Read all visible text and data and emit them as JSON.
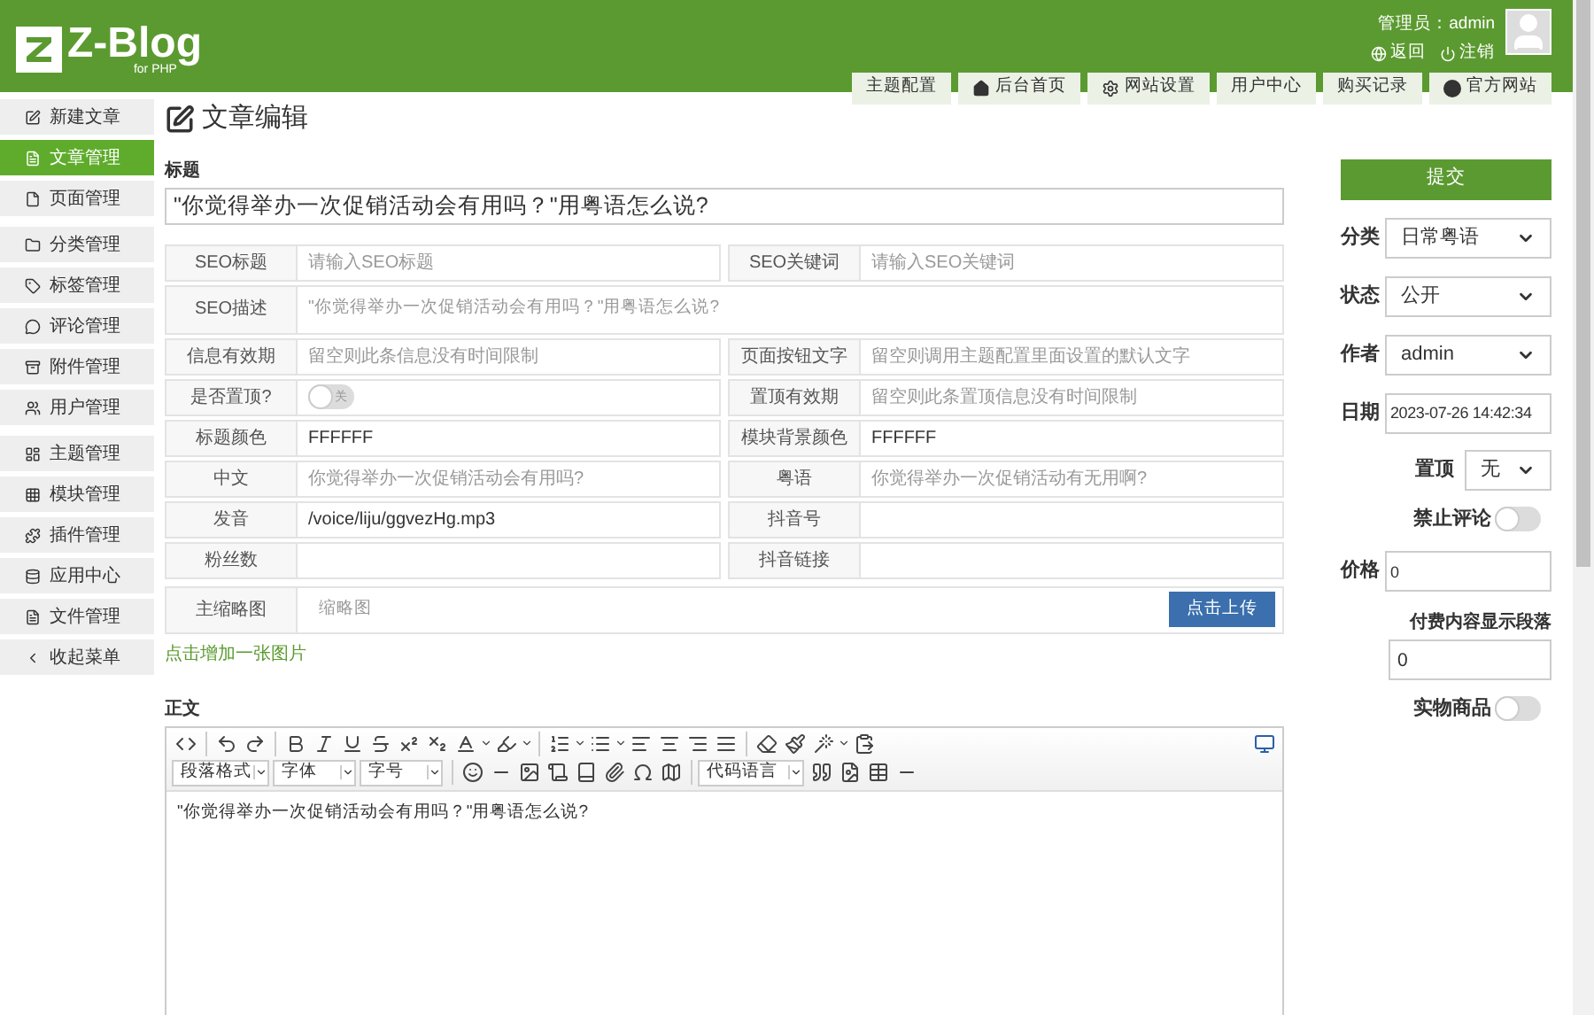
{
  "header": {
    "logo": "Z-Blog",
    "logo_sub": "for PHP",
    "user_label": "管理员：admin",
    "links": [
      "返回",
      "注销"
    ],
    "tabs": [
      {
        "label": "主题配置"
      },
      {
        "label": "后台首页"
      },
      {
        "label": "网站设置"
      },
      {
        "label": "用户中心"
      },
      {
        "label": "购买记录"
      },
      {
        "label": "官方网站"
      }
    ]
  },
  "sidebar": {
    "groups": [
      [
        {
          "label": "新建文章",
          "selected": false
        },
        {
          "label": "文章管理",
          "selected": true
        },
        {
          "label": "页面管理",
          "selected": false
        }
      ],
      [
        {
          "label": "分类管理",
          "selected": false
        },
        {
          "label": "标签管理",
          "selected": false
        },
        {
          "label": "评论管理",
          "selected": false
        },
        {
          "label": "附件管理",
          "selected": false
        },
        {
          "label": "用户管理",
          "selected": false
        }
      ],
      [
        {
          "label": "主题管理",
          "selected": false
        },
        {
          "label": "模块管理",
          "selected": false
        },
        {
          "label": "插件管理",
          "selected": false
        },
        {
          "label": "应用中心",
          "selected": false
        },
        {
          "label": "文件管理",
          "selected": false
        },
        {
          "label": "收起菜单",
          "selected": false
        }
      ]
    ]
  },
  "page_title": "文章编辑",
  "title_label": "标题",
  "title_value": "\"你觉得举办一次促销活动会有用吗？\"用粤语怎么说?",
  "fields": [
    {
      "kind": "pair",
      "left": {
        "label": "SEO标题",
        "placeholder": "请输入SEO标题"
      },
      "right": {
        "label": "SEO关键词",
        "placeholder": "请输入SEO关键词"
      }
    },
    {
      "kind": "textarea",
      "label": "SEO描述",
      "placeholder": "\"你觉得举办一次促销活动会有用吗？\"用粤语怎么说?"
    },
    {
      "kind": "pair",
      "left": {
        "label": "信息有效期",
        "placeholder": "留空则此条信息没有时间限制"
      },
      "right": {
        "label": "页面按钮文字",
        "placeholder": "留空则调用主题配置里面设置的默认文字"
      }
    },
    {
      "kind": "pair",
      "left": {
        "label": "是否置顶?",
        "toggle": {
          "on": false,
          "text": "关"
        }
      },
      "right": {
        "label": "置顶有效期",
        "placeholder": "留空则此条置顶信息没有时间限制"
      }
    },
    {
      "kind": "pair",
      "left": {
        "label": "标题颜色",
        "value": "FFFFFF"
      },
      "right": {
        "label": "模块背景颜色",
        "value": "FFFFFF"
      }
    },
    {
      "kind": "pair",
      "left": {
        "label": "中文",
        "placeholder": "你觉得举办一次促销活动会有用吗?"
      },
      "right": {
        "label": "粤语",
        "placeholder": "你觉得举办一次促销活动有无用啊?"
      }
    },
    {
      "kind": "pair",
      "left": {
        "label": "发音",
        "value": "/voice/liju/ggvezHg.mp3"
      },
      "right": {
        "label": "抖音号"
      }
    },
    {
      "kind": "pair",
      "left": {
        "label": "粉丝数"
      },
      "right": {
        "label": "抖音链接"
      }
    },
    {
      "kind": "upload",
      "label": "主缩略图",
      "placeholder": "缩略图",
      "button": "点击上传"
    }
  ],
  "add_image_link": "点击增加一张图片",
  "body_label": "正文",
  "editor": {
    "selects": [
      "段落格式",
      "字体",
      "字号"
    ],
    "code_select": "代码语言",
    "content": "\"你觉得举办一次促销活动会有用吗？\"用粤语怎么说?"
  },
  "side": {
    "submit": "提交",
    "rows": [
      {
        "kind": "select",
        "label": "分类",
        "value": "日常粤语"
      },
      {
        "kind": "select",
        "label": "状态",
        "value": "公开"
      },
      {
        "kind": "select",
        "label": "作者",
        "value": "admin"
      },
      {
        "kind": "input",
        "label": "日期",
        "value": "2023-07-26 14:42:34"
      },
      {
        "kind": "small_select",
        "label": "置顶",
        "value": "无"
      },
      {
        "kind": "toggle",
        "label": "禁止评论",
        "on": false
      },
      {
        "kind": "input",
        "label": "价格",
        "value": "0"
      },
      {
        "kind": "stacked_input",
        "label": "付费内容显示段落",
        "value": "0"
      },
      {
        "kind": "toggle",
        "label": "实物商品",
        "on": false
      }
    ]
  }
}
